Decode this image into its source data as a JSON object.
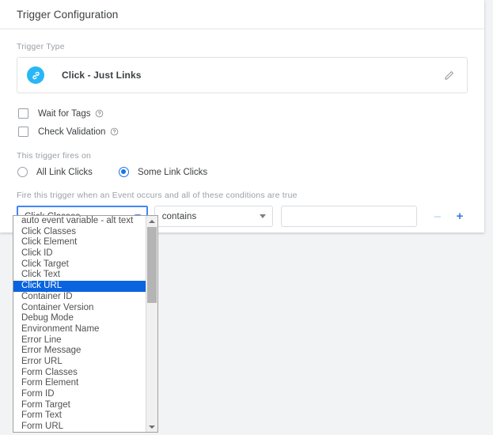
{
  "card": {
    "header_title": "Trigger Configuration",
    "trigger_type_label": "Trigger Type",
    "trigger_type_name": "Click - Just Links",
    "trigger_type_icon": "link-icon",
    "edit_icon": "pencil-icon"
  },
  "checkboxes": [
    {
      "label": "Wait for Tags",
      "checked": false,
      "help_icon": "help-circle-icon"
    },
    {
      "label": "Check Validation",
      "checked": false,
      "help_icon": "help-circle-icon"
    }
  ],
  "radios": {
    "section_label": "This trigger fires on",
    "options": [
      {
        "label": "All Link Clicks",
        "checked": false
      },
      {
        "label": "Some Link Clicks",
        "checked": true
      }
    ]
  },
  "conditions": {
    "section_label": "Fire this trigger when an Event occurs and all of these conditions are true",
    "variable_value": "Click Classes",
    "operator_value": "contains",
    "value_input": "",
    "value_placeholder": "",
    "remove_label": "–",
    "add_label": "+"
  },
  "dropdown": {
    "open": true,
    "selected": "Click URL",
    "options": [
      "auto event variable - alt text",
      "Click Classes",
      "Click Element",
      "Click ID",
      "Click Target",
      "Click Text",
      "Click URL",
      "Container ID",
      "Container Version",
      "Debug Mode",
      "Environment Name",
      "Error Line",
      "Error Message",
      "Error URL",
      "Form Classes",
      "Form Element",
      "Form ID",
      "Form Target",
      "Form Text",
      "Form URL"
    ],
    "scroll_up_icon": "triangle-up-icon",
    "scroll_down_icon": "triangle-down-icon"
  },
  "colors": {
    "accent_blue": "#1a73e8",
    "focus_blue": "#4285f4",
    "icon_blue": "#29b6f6",
    "highlight_blue": "#0a64e0",
    "page_background": "#f1f3f4"
  }
}
